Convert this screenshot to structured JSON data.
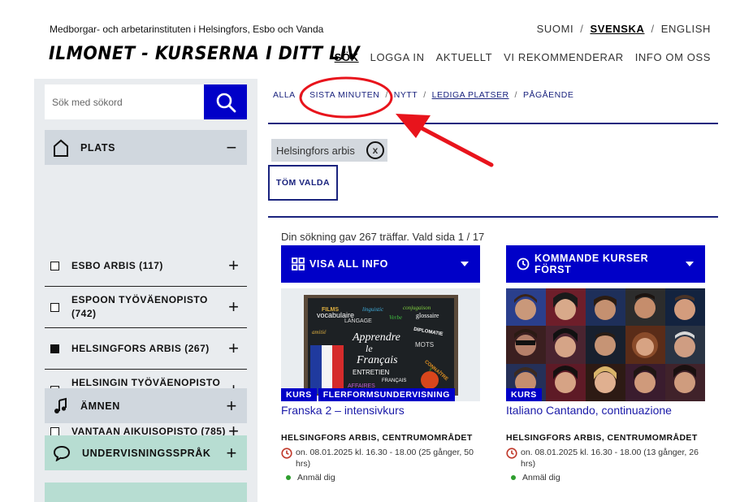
{
  "header": {
    "org": "Medborgar- och arbetarinstituten i Helsingfors, Esbo och Vanda",
    "brand": "ILMONET - KURSERNA I DITT LIV",
    "languages": [
      "SUOMI",
      "SVENSKA",
      "ENGLISH"
    ],
    "active_language": "SVENSKA",
    "nav": [
      "SÖK",
      "LOGGA IN",
      "AKTUELLT",
      "VI REKOMMENDERAR",
      "INFO OM OSS"
    ],
    "active_nav": "SÖK"
  },
  "search": {
    "placeholder": "Sök med sökord",
    "icon": "search-icon"
  },
  "facets": {
    "plats": {
      "label": "PLATS",
      "icon": "house-icon",
      "toggle": "−"
    },
    "places": [
      {
        "name": "ESBO ARBIS (117)",
        "checked": false
      },
      {
        "name": "ESPOON TYÖVÄENOPISTO (742)",
        "checked": false
      },
      {
        "name": "HELSINGFORS ARBIS (267)",
        "checked": true
      },
      {
        "name": "HELSINGIN TYÖVÄENOPISTO (1062)",
        "checked": false
      },
      {
        "name": "VANTAAN AIKUISOPISTO (785)",
        "checked": false
      }
    ],
    "amnen": {
      "label": "ÄMNEN",
      "icon": "music-note-icon",
      "toggle": "+"
    },
    "sprak": {
      "label": "UNDERVISNINGSSPRÅK",
      "icon": "speech-bubble-icon",
      "toggle": "+"
    },
    "plus": "+"
  },
  "filters": [
    "ALLA",
    "SISTA MINUTEN",
    "NYTT",
    "LEDIGA PLATSER",
    "PÅGÅENDE"
  ],
  "selected_chip": {
    "label": "Helsingfors arbis",
    "remove": "x"
  },
  "clear_button": "TÖM VALDA",
  "results_text": "Din sökning gav 267 träffar. Vald sida 1 / 17",
  "view_dropdown": "VISA ALL INFO",
  "sort_dropdown": "KOMMANDE KURSER FÖRST",
  "courses": [
    {
      "tags": [
        "KURS",
        "FLERFORMSUNDERVISNING"
      ],
      "title": "Franska 2 – intensivkurs",
      "location": "HELSINGFORS ARBIS, CENTRUMOMRÅDET",
      "time": "on. 08.01.2025 kl. 16.30 - 18.00 (25 gånger, 50 hrs)",
      "enroll": "Anmäl dig",
      "image": {
        "heading": "Apprendre le Français",
        "words": [
          "FILMS",
          "vocabulaire",
          "linguistic",
          "conjugaison",
          "LANGAGE",
          "Verbe",
          "glossaire",
          "amitié",
          "DIPLOMATIE",
          "MOTS",
          "ENTRETIEN",
          "AFFAIRES",
          "FRANÇAIS",
          "CONNAÎTRE"
        ]
      }
    },
    {
      "tags": [
        "KURS"
      ],
      "title": "Italiano Cantando, continuazione",
      "location": "HELSINGFORS ARBIS, CENTRUMOMRÅDET",
      "time": "on. 08.01.2025 kl. 16.30 - 18.00 (13 gånger, 26 hrs)",
      "enroll": "Anmäl dig"
    }
  ],
  "colors": {
    "primary": "#0000c8",
    "navy": "#1a237e",
    "sidebar": "#e9ecef",
    "facet_grey": "#d0d7de",
    "facet_mint": "#b7ddd2",
    "annotation": "#e8141c"
  }
}
